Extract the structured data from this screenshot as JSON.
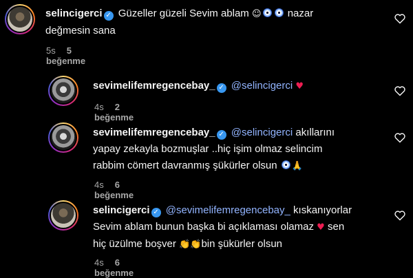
{
  "comments": [
    {
      "username": "selincigerci",
      "text_before": "Güzeller güzeli Sevim ablam ",
      "face_emoji": "☺",
      "text_after": " nazar",
      "line2": "değmesin sana",
      "time": "5s",
      "likes": "5 beğenme"
    },
    {
      "username": "sevimelifemregencebay_",
      "mention": "@selincigerci",
      "heart": "♥",
      "time": "4s",
      "likes": "2 beğenme"
    },
    {
      "username": "sevimelifemregencebay_",
      "mention": "@selincigerci",
      "text_line1": " akıllarını",
      "line2": "yapay zekayla bozmuşlar ..hiç işim olmaz selincim",
      "line3": "rabbim cömert davranmış şükürler olsun",
      "hands_emoji": "🙏",
      "time": "4s",
      "likes": "6 beğenme"
    },
    {
      "username": "selincigerci",
      "mention": "@sevimelifemregencebay_",
      "text_line1": " kıskanıyorlar",
      "line2": "Sevim ablam bunun başka bi açıklaması olamaz ",
      "heart": "♥",
      "line2_end": " sen",
      "line3": "hiç üzülme boşver ",
      "clap_emoji": "👏👏",
      "line3_end": "bin şükürler olsun",
      "time": "4s",
      "likes": "6 beğenme"
    }
  ],
  "colors": {
    "background": "#000000",
    "mention": "#92b4ff",
    "verified": "#3897f0",
    "heart": "#ee1d52",
    "meta": "#a8a8a8"
  },
  "icons": {
    "verified": "verified-badge-icon",
    "like": "heart-outline-icon",
    "evil_eye": "nazar-boncugu-icon"
  }
}
